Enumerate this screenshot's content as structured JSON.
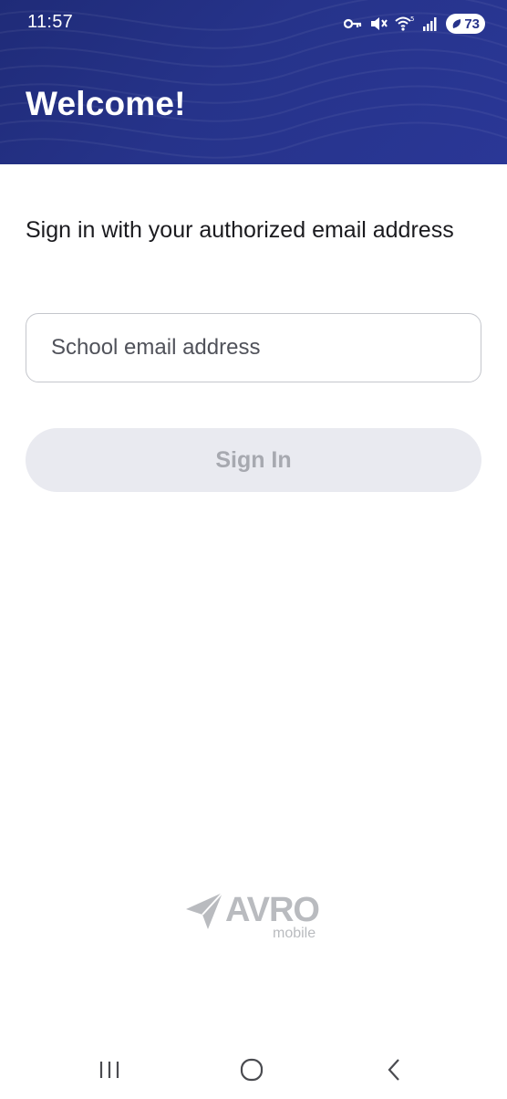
{
  "status_bar": {
    "time": "11:57",
    "battery": "73",
    "icons": [
      "vpn-key-icon",
      "mute-icon",
      "wifi-icon",
      "signal-icon",
      "battery-icon"
    ]
  },
  "header": {
    "title": "Welcome!",
    "background_color": "#26338a"
  },
  "form": {
    "instruction": "Sign in with your authorized email address",
    "email_placeholder": "School email address",
    "email_value": "",
    "sign_in_label": "Sign In"
  },
  "branding": {
    "logo_text": "AVRO",
    "logo_subtext": "mobile"
  },
  "nav_bar": {
    "icons": [
      "recents-icon",
      "home-icon",
      "back-icon"
    ]
  }
}
